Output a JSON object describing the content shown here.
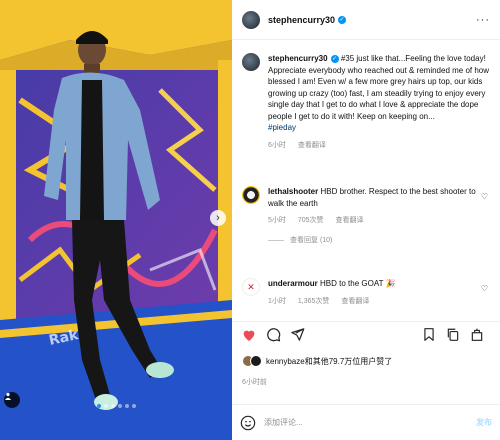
{
  "post": {
    "username": "stephencurry30",
    "caption": {
      "username": "stephencurry30",
      "text": "#35 just like that...Feeling the love today! Appreciate everybody who reached out & reminded me of how blessed I am! Even w/ a few more grey hairs up top, our kids growing up crazy (too) fast, I am steadily trying to enjoy every single day that I get to do what I love & appreciate the dope people I get to do it with! Keep on keeping on...",
      "hashtag": "#pieday",
      "time": "6小时",
      "translate": "查看翻译"
    },
    "comments": [
      {
        "username": "lethalshooter",
        "text": "HBD brother. Respect to the best shooter to walk the earth",
        "time": "5小时",
        "likes": "705次赞",
        "translate": "查看翻译",
        "replies": "查看回复 (10)"
      },
      {
        "username": "underarmour",
        "text": "HBD to the GOAT 🎉",
        "time": "1小时",
        "likes": "1,365次赞",
        "translate": "查看翻译"
      }
    ],
    "likes_text": "kennybaze和其他79.7万位用户赞了",
    "posted": "6小时前",
    "comment_placeholder": "添加评论...",
    "post_button": "发布"
  },
  "colors": {
    "verified": "#0095f6",
    "like_red": "#ed4956",
    "hashtag": "#00376b"
  },
  "carousel": {
    "slide_count": 6,
    "active_slide": 1
  },
  "icons": {
    "more": "more-icon",
    "like": "heart-icon",
    "comment": "comment-icon",
    "share": "share-icon",
    "save": "bookmark-icon",
    "emoji": "emoji-icon"
  }
}
